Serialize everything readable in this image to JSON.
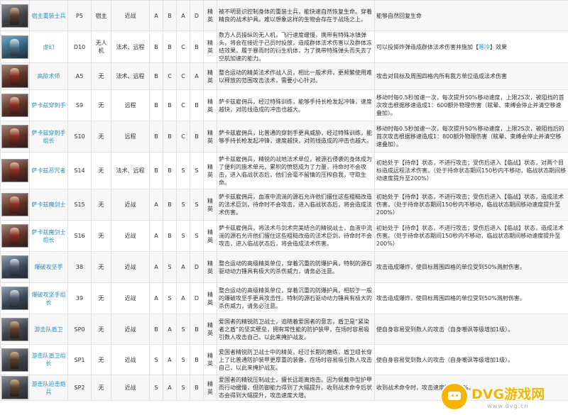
{
  "rows": [
    {
      "icon": "hooded-soldier-portrait",
      "name": "宿主重装士兵",
      "code": "P5",
      "attr": "宿主",
      "range": "近战",
      "r1": "A",
      "r2": "B",
      "r3": "A",
      "r4": "D",
      "level": "精英",
      "desc": "被不明意识控制身体的重装士兵，能快速自然恢复生命。穿着精良的战术护具。难以想象这样的生物会存在于战场之上。",
      "ability": "能够自然回复生命",
      "ability_pre": "",
      "ability_tag": "",
      "ability_post": ""
    },
    {
      "icon": "drone-portrait",
      "name": "虚幻",
      "code": "D10",
      "attr": "无人机",
      "range": "法术、远程",
      "r1": "B",
      "r2": "B",
      "r3": "C",
      "r4": "B",
      "level": "精英",
      "desc": "数方人员操纵的无人机，飞行速度缓慢，携带有特殊冰镇弹头，将会在接近于己员时投放，造成群体法术伤害以及群体冻结效果。履于暴雨时的衍生机体，为了携带特殊弹头而失去了空航加速的能力。",
      "ability": "",
      "ability_pre": "可以投掷炸弹造成群体法术伤害并施加【",
      "ability_tag": "寒冷",
      "ability_post": "】效果"
    },
    {
      "icon": "caster-portrait",
      "name": "高阶术师",
      "code": "A5",
      "attr": "无",
      "range": "法术、远程",
      "r1": "B",
      "r2": "C",
      "r3": "C",
      "r4": "A",
      "level": "精英",
      "desc": "整合运动的精英法术作战人员，相比一般术师，更频繁使用难以释放的范围攻击法术，需要小心针对。",
      "ability": "攻击对目标及周围四格内所有我方单位造成法术伤害",
      "ability_pre": "",
      "ability_tag": "",
      "ability_post": ""
    },
    {
      "icon": "sarkaz-spearman-portrait",
      "name": "萨卡兹穿刺手",
      "code": "S9",
      "attr": "无",
      "range": "远程",
      "r1": "B",
      "r2": "B",
      "r3": "C",
      "r4": "B",
      "level": "精英",
      "desc": "萨卡兹雇佣兵，经过特殊训练，能够手持长枪发起冲锋，速度越快，对防线造成的冲击也越大。",
      "ability": "移动时每0.5秒加速一次，每次提升50%移动速度，上限25次，被阻挡的首次攻击根据移速造成1：600额外物理伤害（眩晕、束缚会停止并清空移速叠加）。",
      "ability_pre": "",
      "ability_tag": "",
      "ability_post": ""
    },
    {
      "icon": "sarkaz-spearman-leader-portrait",
      "name": "萨卡兹穿刺手组长",
      "code": "S10",
      "attr": "无",
      "range": "远程",
      "r1": "B",
      "r2": "B",
      "r3": "C",
      "r4": "B",
      "level": "精英",
      "desc": "萨卡兹雇佣兵，比普通的穿刺手更具威胁，经过特殊训练，能够手持长枪发起冲锋，速度越快，对防线造成的冲击也越大。",
      "ability": "移动时每0.5秒加速一次，每次提升50%移动速度，上限25次，被阻挡后的首次攻击根据移速造成1：800额外物理伤害（眩晕、束缚会停止并清空移速叠加）。",
      "ability_pre": "",
      "ability_tag": "",
      "ability_post": ""
    },
    {
      "icon": "sarkaz-caster-portrait",
      "name": "萨卡兹恶咒者",
      "code": "S14",
      "attr": "无",
      "range": "法术、远程",
      "r1": "B",
      "r2": "B",
      "r3": "S",
      "r4": "S",
      "level": "精英",
      "desc": "萨卡兹雇佣兵，精锐的战地法术单位，被源石侵袭的身体成为了便利的施术单元，累积的愤怒成为了力量，待命时不会攻击，进入临战状态后，他们会毫不留情的压榨自我，守取生命。",
      "ability": "初始处于【待命】状态，不进行攻击；受伤后进入【临战】状态，对两个目标造成远程法术伤害。（处于待命状态期间150秒内不移动，临战状态期间移动速度提升至200%）",
      "ability_pre": "",
      "ability_tag": "",
      "ability_post": ""
    },
    {
      "icon": "sarkaz-swordsman-portrait",
      "name": "萨卡兹魔剑士",
      "code": "S15",
      "attr": "无",
      "range": "近战",
      "r1": "A",
      "r2": "B",
      "r3": "S",
      "r4": "S",
      "level": "精英",
      "desc": "萨卡兹雇佣兵，血液中流淌的源石允许他们擅住这些粗糙改造的法术巨剑，待命时不会攻击，进入临战状态后，将会造成法术伤害。",
      "ability": "初始处于【待命】状态，不进行攻击；受伤后进入【临战】状态，造成法术伤害。（处于待命状态期间150秒内不移动，临战状态期间移动速度提升至200%）",
      "ability_pre": "",
      "ability_tag": "",
      "ability_post": ""
    },
    {
      "icon": "sarkaz-swordsman-leader-portrait",
      "name": "萨卡兹魔剑士组长",
      "code": "S16",
      "attr": "无",
      "range": "近战",
      "r1": "A",
      "r2": "B",
      "r3": "S",
      "r4": "S",
      "level": "精英",
      "desc": "萨卡兹雇佣兵，将法术与剑术完美结合的精锐战士，血液中流淌的源石允许他们擅住这些粗糙改造的法术巨剑，待命时不会攻击，进入临战状态后，将会造成法术伤害。",
      "ability": "初始处于【待命】状态，不进行攻击；受伤后进入【临战】状态，造成法术伤害。（处于待命状态期间150秒内不移动，临战状态期间移动速度提升至200%）",
      "ability_pre": "",
      "ability_tag": "",
      "ability_post": ""
    },
    {
      "icon": "demolition-soldier-portrait",
      "name": "爆破攻坚手",
      "code": "38",
      "attr": "无",
      "range": "近战",
      "r1": "A",
      "r2": "S",
      "r3": "A",
      "r4": "D",
      "level": "精英",
      "desc": "整合运动的高级精英单位，穿着沉重的防爆护具，特制的源石驱动动力锤具有极大的杀伤威力，请务必注意。",
      "ability": "攻击造成爆炸，使目标周围四格的单位受到50%溅射伤害。",
      "ability_pre": "",
      "ability_tag": "",
      "ability_post": ""
    },
    {
      "icon": "demolition-leader-portrait",
      "name": "爆破攻坚手组长",
      "code": "39",
      "attr": "无",
      "range": "近战",
      "r1": "A",
      "r2": "S",
      "r3": "A",
      "r4": "D",
      "level": "精英",
      "desc": "整合运动的高级精英单位，穿着沉重的防爆护具，相较于一般的爆破攻坚手更具攻击性。特制的源石驱动动力锤具有极大的杀伤威力，请务必注意。",
      "ability": "攻击造成爆炸，使目标周围四格的单位受到50%溅射伤害。",
      "ability_pre": "",
      "ability_tag": "",
      "ability_post": ""
    },
    {
      "icon": "guerrilla-shield-guard-portrait",
      "name": "游击队盾卫",
      "code": "SP0",
      "attr": "无",
      "range": "近战",
      "r1": "B",
      "r2": "A",
      "r3": "S",
      "r4": "B",
      "level": "精英",
      "desc": "爱国者的精锐防卫战士，追随着爱国者的意志，盾卫是“紧染者之盾”的坚实壁垒，拥有常性能的防护装甲，在场时容易吸引数人攻击自己，以此来掩护战友。",
      "ability": "使自身容易受到数人的攻击（自身嘲讽等级增加1级）。",
      "ability_pre": "",
      "ability_tag": "",
      "ability_post": ""
    },
    {
      "icon": "guerrilla-shield-leader-portrait",
      "name": "游击队盾卫组长",
      "code": "SP1",
      "attr": "无",
      "range": "近战",
      "r1": "S",
      "r2": "A",
      "r3": "S",
      "r4": "B",
      "level": "精英",
      "desc": "爱国者精锐防卫战士中的精英，经过长期的磨练，盾卫组长穿上了比普通防护装甲更厚重的装备，在场时容易吸引数人攻击自己，以此来掩护战友。",
      "ability": "使自身容易受到数人的攻击（自身嘲讽等级增加1级）。",
      "ability_pre": "",
      "ability_tag": "",
      "ability_post": ""
    },
    {
      "icon": "guerrilla-assault-portrait",
      "name": "游击队迫击炮兵",
      "code": "SP2",
      "attr": "无",
      "range": "近战",
      "r1": "S",
      "r2": "A",
      "r3": "S",
      "r4": "B",
      "level": "精英",
      "desc": "爱国者的精锐压制战士，擅长远距离炮击。因为佩戴中型护甲而行动缓慢，但防御能力得到了大幅提升。收到战术命令后状态会得到大幅提升，攻击速度大增。",
      "ability": "收到战术命令时，攻击速度提升50%。",
      "ability_pre": "",
      "ability_tag": "",
      "ability_post": ""
    }
  ],
  "watermark": {
    "title": "DVG游戏网",
    "url": "www.dvg.cn",
    "icon": "gamepad-icon"
  }
}
